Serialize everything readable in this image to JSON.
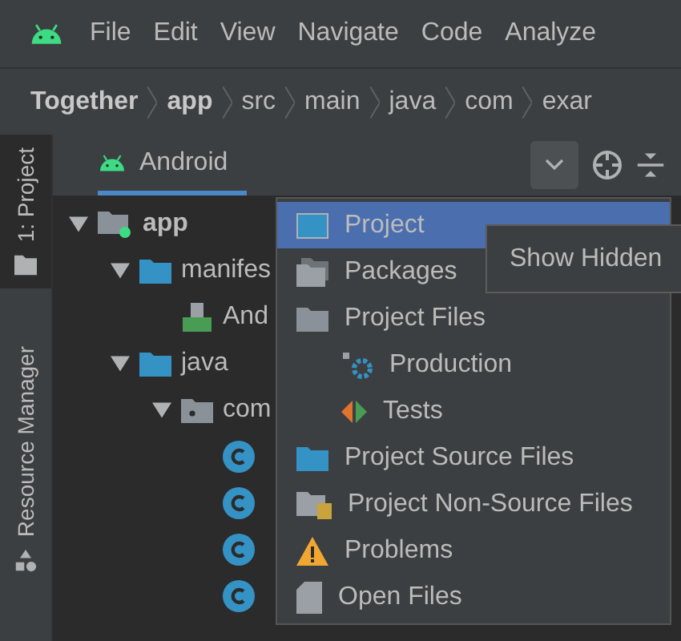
{
  "menu_bar": {
    "items": [
      "File",
      "Edit",
      "View",
      "Navigate",
      "Code",
      "Analyze"
    ]
  },
  "breadcrumbs": [
    {
      "label": "Together",
      "bold": true
    },
    {
      "label": "app",
      "bold": true
    },
    {
      "label": "src",
      "bold": false
    },
    {
      "label": "main",
      "bold": false
    },
    {
      "label": "java",
      "bold": false
    },
    {
      "label": "com",
      "bold": false
    },
    {
      "label": "exar",
      "bold": false
    }
  ],
  "side_tabs": [
    {
      "label": "1: Project",
      "selected": true
    },
    {
      "label": "Resource Manager",
      "selected": false
    }
  ],
  "tool_window": {
    "view": "Android"
  },
  "tree": [
    {
      "label": "app",
      "kind": "module",
      "bold": true,
      "expanded": true,
      "children": [
        {
          "label": "manifes",
          "kind": "folder",
          "expanded": true,
          "children": [
            {
              "label": "And",
              "kind": "manifest"
            }
          ]
        },
        {
          "label": "java",
          "kind": "folder",
          "expanded": true,
          "children": [
            {
              "label": "com",
              "kind": "package",
              "expanded": true,
              "children": [
                {
                  "kind": "class"
                },
                {
                  "kind": "class"
                },
                {
                  "kind": "class"
                },
                {
                  "kind": "class"
                }
              ]
            }
          ]
        }
      ]
    }
  ],
  "view_menu": [
    {
      "label": "Project",
      "kind": "project",
      "selected": true
    },
    {
      "label": "Packages",
      "kind": "packages",
      "selected": false
    },
    {
      "label": "Project Files",
      "kind": "folder",
      "selected": false
    },
    {
      "label": "Production",
      "kind": "production",
      "selected": false,
      "sub": true
    },
    {
      "label": "Tests",
      "kind": "tests",
      "selected": false,
      "sub": true
    },
    {
      "label": "Project Source Files",
      "kind": "source",
      "selected": false
    },
    {
      "label": "Project Non-Source Files",
      "kind": "nonsource",
      "selected": false
    },
    {
      "label": "Problems",
      "kind": "problems",
      "selected": false
    },
    {
      "label": "Open Files",
      "kind": "open",
      "selected": false
    }
  ],
  "tooltip": "Show Hidden"
}
